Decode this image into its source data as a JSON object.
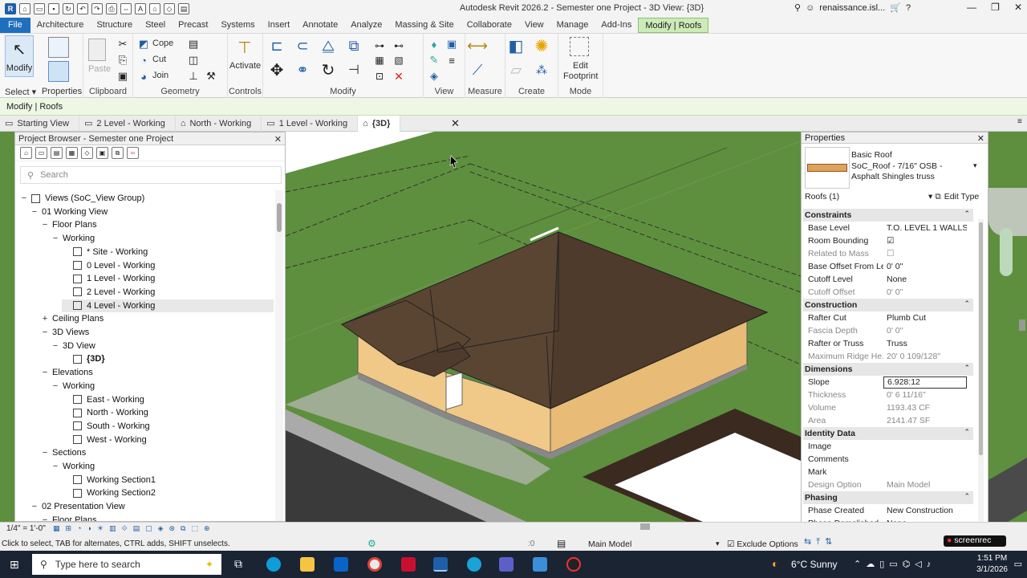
{
  "app": {
    "title": "Autodesk Revit 2026.2 - Semester one Project - 3D View: {3D}",
    "user": "renaissance.isl..."
  },
  "menu": [
    "File",
    "Architecture",
    "Structure",
    "Steel",
    "Precast",
    "Systems",
    "Insert",
    "Annotate",
    "Analyze",
    "Massing & Site",
    "Collaborate",
    "View",
    "Manage",
    "Add-Ins",
    "Modify | Roofs"
  ],
  "ribbon": {
    "modify": "Modify",
    "select": "Select",
    "properties": "Properties",
    "clipboard": "Clipboard",
    "paste": "Paste",
    "geometry": "Geometry",
    "cope": "Cope",
    "cut": "Cut",
    "join": "Join",
    "controls": "Controls",
    "activate": "Activate",
    "modify_panel": "Modify",
    "view": "View",
    "measure": "Measure",
    "create": "Create",
    "mode": "Mode",
    "edit": "Edit",
    "footprint": "Footprint"
  },
  "context": "Modify | Roofs",
  "viewtabs": [
    "Starting View",
    "2 Level - Working",
    "North - Working",
    "1 Level - Working",
    "{3D}"
  ],
  "browser": {
    "title": "Project Browser - Semester one Project",
    "search_placeholder": "Search",
    "tree": [
      {
        "t": "Views (SoC_View Group)",
        "lvl": 0,
        "tog": "−"
      },
      {
        "t": "01 Working View",
        "lvl": 1,
        "tog": "−"
      },
      {
        "t": "Floor Plans",
        "lvl": 2,
        "tog": "−"
      },
      {
        "t": "Working",
        "lvl": 3,
        "tog": "−"
      },
      {
        "t": "* Site - Working",
        "lvl": 4,
        "tog": "",
        "v": true
      },
      {
        "t": "0 Level - Working",
        "lvl": 4,
        "tog": "",
        "v": true
      },
      {
        "t": "1 Level - Working",
        "lvl": 4,
        "tog": "",
        "v": true
      },
      {
        "t": "2 Level - Working",
        "lvl": 4,
        "tog": "",
        "v": true
      },
      {
        "t": "4 Level - Working",
        "lvl": 4,
        "tog": "",
        "v": true,
        "sel": true
      },
      {
        "t": "Ceiling Plans",
        "lvl": 2,
        "tog": "+"
      },
      {
        "t": "3D Views",
        "lvl": 2,
        "tog": "−"
      },
      {
        "t": "3D View",
        "lvl": 3,
        "tog": "−"
      },
      {
        "t": "{3D}",
        "lvl": 4,
        "tog": "",
        "v": true,
        "bold": true
      },
      {
        "t": "Elevations",
        "lvl": 2,
        "tog": "−"
      },
      {
        "t": "Working",
        "lvl": 3,
        "tog": "−"
      },
      {
        "t": "East - Working",
        "lvl": 4,
        "tog": "",
        "v": true
      },
      {
        "t": "North - Working",
        "lvl": 4,
        "tog": "",
        "v": true
      },
      {
        "t": "South - Working",
        "lvl": 4,
        "tog": "",
        "v": true
      },
      {
        "t": "West - Working",
        "lvl": 4,
        "tog": "",
        "v": true
      },
      {
        "t": "Sections",
        "lvl": 2,
        "tog": "−"
      },
      {
        "t": "Working",
        "lvl": 3,
        "tog": "−"
      },
      {
        "t": "Working Section1",
        "lvl": 4,
        "tog": "",
        "v": true
      },
      {
        "t": "Working Section2",
        "lvl": 4,
        "tog": "",
        "v": true
      },
      {
        "t": "02 Presentation View",
        "lvl": 1,
        "tog": "−"
      },
      {
        "t": "Floor Plans",
        "lvl": 2,
        "tog": "−"
      }
    ]
  },
  "props": {
    "title": "Properties",
    "family": "Basic Roof",
    "type": "SoC_Roof - 7/16\" OSB - Asphalt Shingles truss",
    "filter": "Roofs (1)",
    "edit_type": "Edit Type",
    "rows": [
      {
        "g": "Constraints"
      },
      {
        "k": "Base Level",
        "v": "T.O. LEVEL 1 WALLS"
      },
      {
        "k": "Room Bounding",
        "v": "☑"
      },
      {
        "k": "Related to Mass",
        "v": "☐",
        "grey": true
      },
      {
        "k": "Base Offset From Le...",
        "v": "0'  0\""
      },
      {
        "k": "Cutoff Level",
        "v": "None"
      },
      {
        "k": "Cutoff Offset",
        "v": "0'  0\"",
        "grey": true
      },
      {
        "g": "Construction"
      },
      {
        "k": "Rafter Cut",
        "v": "Plumb Cut"
      },
      {
        "k": "Fascia Depth",
        "v": "0'  0\"",
        "grey": true
      },
      {
        "k": "Rafter or Truss",
        "v": "Truss"
      },
      {
        "k": "Maximum Ridge He...",
        "v": "20'  0 109/128\"",
        "grey": true
      },
      {
        "g": "Dimensions"
      },
      {
        "k": "Slope",
        "v": "6.928:12",
        "edit": true
      },
      {
        "k": "Thickness",
        "v": "0'  6 11/16\"",
        "grey": true
      },
      {
        "k": "Volume",
        "v": "1193.43 CF",
        "grey": true
      },
      {
        "k": "Area",
        "v": "2141.47 SF",
        "grey": true
      },
      {
        "g": "Identity Data"
      },
      {
        "k": "Image",
        "v": ""
      },
      {
        "k": "Comments",
        "v": ""
      },
      {
        "k": "Mark",
        "v": ""
      },
      {
        "k": "Design Option",
        "v": "Main Model",
        "grey": true
      },
      {
        "g": "Phasing"
      },
      {
        "k": "Phase Created",
        "v": "New Construction"
      },
      {
        "k": "Phase Demolished",
        "v": "None"
      }
    ]
  },
  "status": {
    "scale": "1/4\" = 1'-0\"",
    "hint": "Click to select, TAB for alternates, CTRL adds, SHIFT unselects.",
    "model": "Main Model",
    "exclude": "Exclude Options",
    "zero": ":0",
    "rec": "screenrec"
  },
  "taskbar": {
    "search": "Type here to search",
    "weather": "6°C  Sunny",
    "time": "1:51 PM",
    "date": "3/1/2026"
  }
}
